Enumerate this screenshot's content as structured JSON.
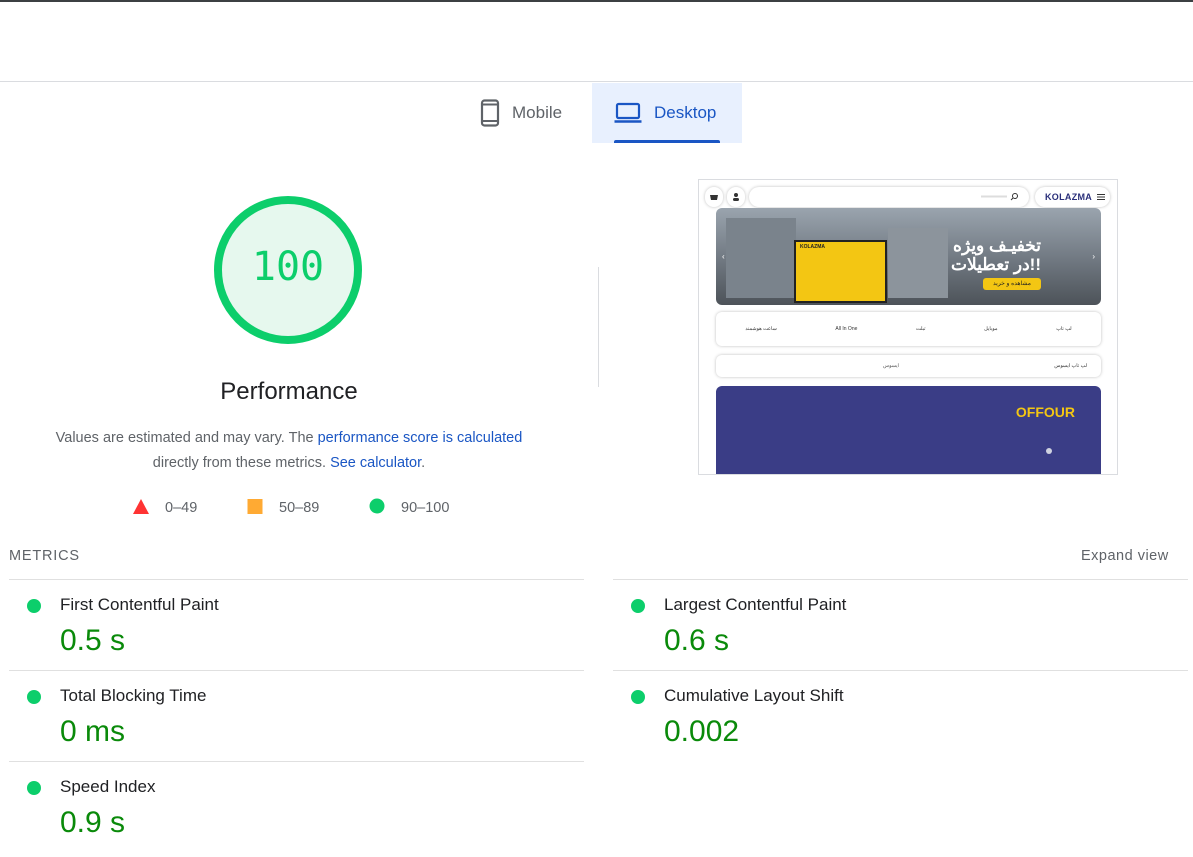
{
  "tabs": [
    {
      "label": "Mobile",
      "icon": "smartphone-icon",
      "selected": false
    },
    {
      "label": "Desktop",
      "icon": "laptop-icon",
      "selected": true
    }
  ],
  "gauge": {
    "score": "100",
    "fraction": 1.0,
    "color": "#0cce6b"
  },
  "performance": {
    "title": "Performance",
    "desc_prefix": "Values are estimated and may vary. The ",
    "desc_link1": "performance score is calculated",
    "desc_middle": "directly from these metrics. ",
    "desc_link2": "See calculator",
    "desc_suffix": "."
  },
  "legend": [
    {
      "range": "0–49",
      "shape": "triangle",
      "color": "#ff3333"
    },
    {
      "range": "50–89",
      "shape": "square",
      "color": "#ffaa33"
    },
    {
      "range": "90–100",
      "shape": "circle",
      "color": "#0cce6b"
    }
  ],
  "screenshot": {
    "logo": "KOLAZMA",
    "banner_text_1": "تخفیـف ویژه",
    "banner_text_2": "در تعطیلات!!",
    "banner_button": "مشاهده و خرید",
    "store_sign": "KOLAZMA",
    "categories": [
      "لپ تاپ",
      "موبایل",
      "تبلت",
      "All In One",
      "ساعت هوشمند"
    ],
    "search_right": "لپ تاپ ایسوس",
    "search_left": "ایسوس",
    "promo_logo": "OFFOUR"
  },
  "metrics_section": {
    "label": "METRICS",
    "expand": "Expand view"
  },
  "metrics": [
    {
      "name": "First Contentful Paint",
      "value": "0.5 s"
    },
    {
      "name": "Largest Contentful Paint",
      "value": "0.6 s"
    },
    {
      "name": "Total Blocking Time",
      "value": "0 ms"
    },
    {
      "name": "Cumulative Layout Shift",
      "value": "0.002"
    },
    {
      "name": "Speed Index",
      "value": "0.9 s"
    }
  ]
}
